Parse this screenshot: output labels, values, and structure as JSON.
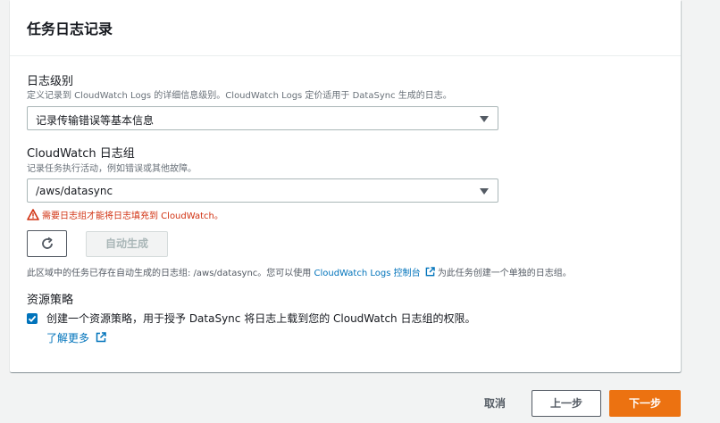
{
  "panel": {
    "title": "任务日志记录"
  },
  "log_level": {
    "label": "日志级别",
    "description": "定义记录到 CloudWatch Logs 的详细信息级别。CloudWatch Logs 定价适用于 DataSync 生成的日志。",
    "selected": "记录传输错误等基本信息"
  },
  "log_group": {
    "label": "CloudWatch 日志组",
    "description": "记录任务执行活动，例如错误或其他故障。",
    "selected": "/aws/datasync",
    "error": "需要日志组才能将日志填充到 CloudWatch。",
    "auto_generate_label": "自动生成",
    "info_prefix": "此区域中的任务已存在自动生成的日志组: /aws/datasync。您可以使用 ",
    "info_link": "CloudWatch Logs 控制台",
    "info_suffix": "为此任务创建一个单独的日志组。"
  },
  "resource_policy": {
    "label": "资源策略",
    "checkbox_label": "创建一个资源策略，用于授予 DataSync 将日志上载到您的 CloudWatch 日志组的权限。",
    "checked": true,
    "learn_more": "了解更多"
  },
  "footer": {
    "cancel": "取消",
    "previous": "上一步",
    "next": "下一步"
  },
  "colors": {
    "link": "#0073bb",
    "error": "#d13212",
    "primary": "#ec7211"
  }
}
